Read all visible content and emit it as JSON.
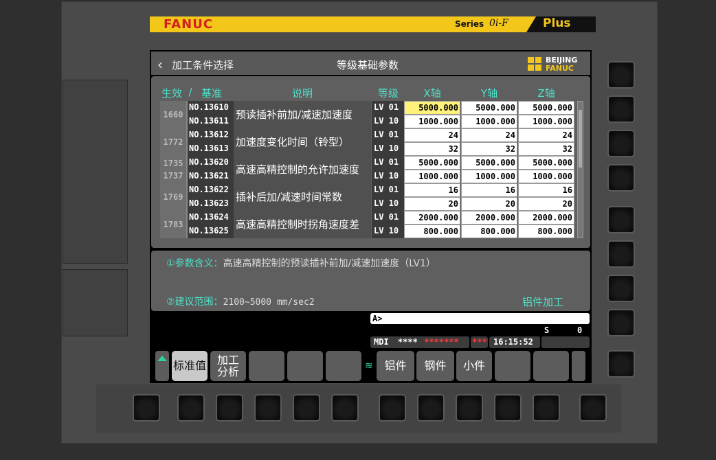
{
  "brand": {
    "name": "FANUC",
    "series": "Series",
    "model": "0i-F",
    "plus": "Plus"
  },
  "titlebar": {
    "back_label": "加工条件选择",
    "title": "等级基础参数",
    "logo_line1": "BEIJING",
    "logo_line2": "FANUC"
  },
  "table": {
    "headers": {
      "enable": "生效",
      "slash": "/",
      "base": "基准",
      "desc": "说明",
      "level": "等级",
      "x": "X轴",
      "y": "Y轴",
      "z": "Z轴"
    },
    "groups": [
      {
        "ids": [
          "1660"
        ],
        "desc": "预读插补前加/减速加速度",
        "rows": [
          {
            "no": "NO.13610",
            "lv": "LV 01",
            "x": "5000.000",
            "y": "5000.000",
            "z": "5000.000"
          },
          {
            "no": "NO.13611",
            "lv": "LV 10",
            "x": "1000.000",
            "y": "1000.000",
            "z": "1000.000"
          }
        ]
      },
      {
        "ids": [
          "1772"
        ],
        "desc": "加速度变化时间（铃型）",
        "rows": [
          {
            "no": "NO.13612",
            "lv": "LV 01",
            "x": "24",
            "y": "24",
            "z": "24"
          },
          {
            "no": "NO.13613",
            "lv": "LV 10",
            "x": "32",
            "y": "32",
            "z": "32"
          }
        ]
      },
      {
        "ids": [
          "1735",
          "1737"
        ],
        "desc": "高速高精控制的允许加速度",
        "rows": [
          {
            "no": "NO.13620",
            "lv": "LV 01",
            "x": "5000.000",
            "y": "5000.000",
            "z": "5000.000"
          },
          {
            "no": "NO.13621",
            "lv": "LV 10",
            "x": "1000.000",
            "y": "1000.000",
            "z": "1000.000"
          }
        ]
      },
      {
        "ids": [
          "1769"
        ],
        "desc": "插补后加/减速时间常数",
        "rows": [
          {
            "no": "NO.13622",
            "lv": "LV 01",
            "x": "16",
            "y": "16",
            "z": "16"
          },
          {
            "no": "NO.13623",
            "lv": "LV 10",
            "x": "20",
            "y": "20",
            "z": "20"
          }
        ]
      },
      {
        "ids": [
          "1783"
        ],
        "desc": "高速高精控制时拐角速度差",
        "rows": [
          {
            "no": "NO.13624",
            "lv": "LV 01",
            "x": "2000.000",
            "y": "2000.000",
            "z": "2000.000"
          },
          {
            "no": "NO.13625",
            "lv": "LV 10",
            "x": "800.000",
            "y": "800.000",
            "z": "800.000"
          }
        ]
      }
    ]
  },
  "info": {
    "meaning_label": "①参数含义：",
    "meaning_value": "高速高精控制的预读插补前加/减速加速度（LV1）",
    "range_label": "②建议范围：",
    "range_value": "2100~5000 mm/sec2",
    "mode_label": "铝件加工"
  },
  "status": {
    "cmd_prompt": "A>",
    "s_label": "S",
    "s_value": "0",
    "mode": "MDI",
    "stars1": "****",
    "stars2": "*******",
    "stars3": "***",
    "time": "16:15:52"
  },
  "softkeys": {
    "standard": "标准值",
    "analysis_1": "加工",
    "analysis_2": "分析",
    "aluminum": "铝件",
    "steel": "钢件",
    "small": "小件"
  },
  "colors": {
    "accent": "#4fe0c8",
    "brand_yellow": "#f3c61a",
    "brand_red": "#d0201c",
    "selected_cell": "#fff27a",
    "status_red": "#ff3b3b"
  }
}
